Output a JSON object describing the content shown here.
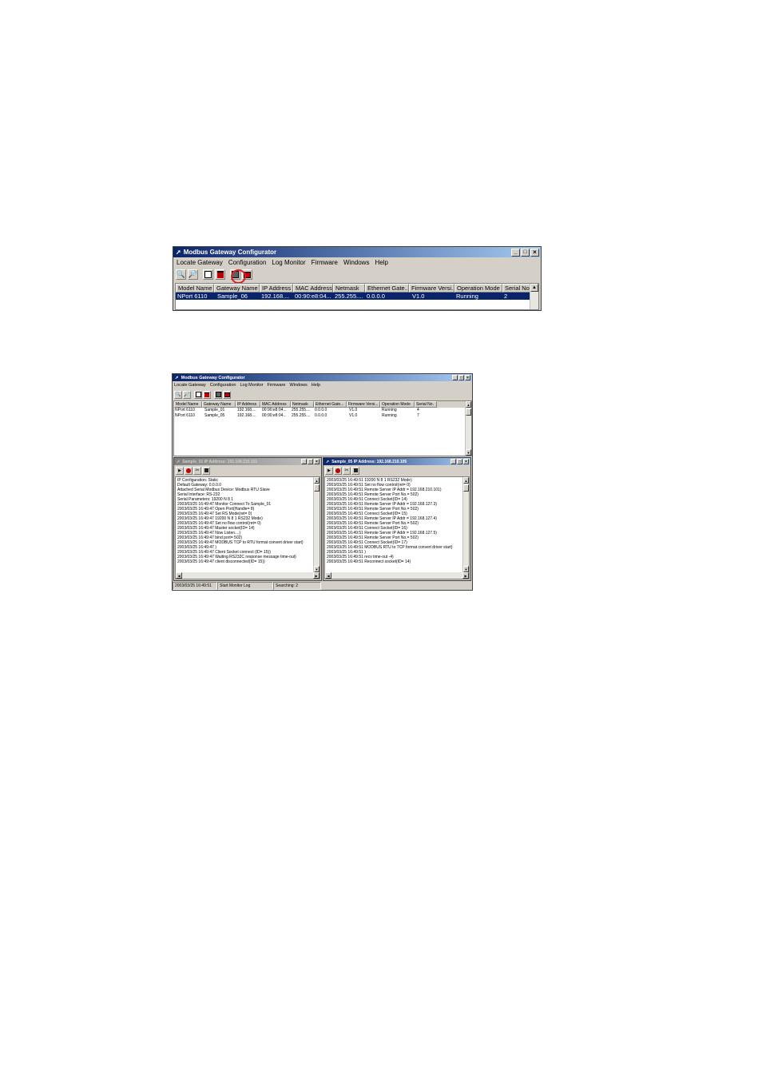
{
  "app": {
    "title": "Modbus Gateway Configurator",
    "menu": [
      "Locate Gateway",
      "Configuration",
      "Log Monitor",
      "Firmware",
      "Windows",
      "Help"
    ],
    "caption_buttons": [
      "_",
      "□",
      "×"
    ],
    "toolbar_icons": [
      "locate-icon",
      "locate-by-ip-icon",
      "configure-icon",
      "unlock-icon",
      "monitor-icon",
      "export-icon"
    ]
  },
  "top_window": {
    "columns": [
      "Model Name",
      "Gateway Name",
      "IP Address",
      "MAC Address",
      "Netmask",
      "Ethernet Gate...",
      "Firmware Versi...",
      "Operation Mode",
      "Serial No."
    ],
    "rows": [
      [
        "NPort 6110",
        "Sample_06",
        "192.168....",
        "00:90:e8:04...",
        "255.255....",
        "0.0.0.0",
        "V1.0",
        "Running",
        "2"
      ]
    ]
  },
  "bottom_window": {
    "columns": [
      "Model Name",
      "Gateway Name",
      "IP Address",
      "MAC Address",
      "Netmask",
      "Ethernet Gate...",
      "Firmware Versi...",
      "Operation Mode",
      "Serial No."
    ],
    "rows": [
      [
        "NPort 6110",
        "Sample_01",
        "192.168....",
        "00:90:e8:04...",
        "255.255....",
        "0.0.0.0",
        "V1.0",
        "Running",
        "4"
      ],
      [
        "NPort 6110",
        "Sample_05",
        "192.168....",
        "00:90:e8:04...",
        "255.255....",
        "0.0.0.0",
        "V1.0",
        "Running",
        "7"
      ]
    ],
    "log_left": {
      "title": "Sample_01 IP Address: 192.168.210.101",
      "lines": [
        "IP Configuration: Static",
        "Default Gateway: 0.0.0.0",
        "Attached Serial Modbus Device: Modbus RTU Slave",
        "Serial Interface: RS-232",
        "Serial Parameters: 19200 N 8 1",
        "2003/03/25 16:49:47 Monitor Connect To Sample_01",
        "2003/03/25 16:49:47 Open Port(Handle= 8)",
        "2003/03/25 16:49:47 Set RS Mode(ret= 0)",
        "2003/03/25 16:49:47 19200 N 8 1 RS232 Mode)",
        "2003/03/25 16:49:47 Set no flow control(ret= 0)",
        "2003/03/25 16:49:47 Master socket(ID= 14)",
        "2003/03/25 16:49:47 Now Listen....)",
        "2003/03/25 16:49:47 bind port= 502)",
        "2003/03/25 16:49:47 MODBUS TCP to RTU format convert driver start)",
        "2003/03/25 16:49:47 )",
        "2003/03/25 16:49:47 Client Socket connect (ID= 15))",
        "2003/03/25 16:49:47 Waiting RS232C response message time-out)",
        "2003/03/25 16:49:47 client disconnected(ID= 15))"
      ]
    },
    "log_right": {
      "title": "Sample_05 IP Address: 192.168.210.105",
      "lines": [
        "2003/03/25 16:49:51 19200 N 8 1 RS232 Mode)",
        "2003/03/25 16:49:51 Set no flow control(ret= 0)",
        "2003/03/25 16:49:51 Remote Server IP Addr = 192.168.210.101)",
        "2003/03/25 16:49:51 Remote Server Port No.= 502)",
        "2003/03/25 16:49:51 Connect Socket(ID= 14)",
        "2003/03/25 16:49:51 Remote Server IP Addr = 192.168.127.3)",
        "2003/03/25 16:49:51 Remote Server Port No.= 502)",
        "2003/03/25 16:49:51 Connect Socket(ID= 15)",
        "2003/03/25 16:49:51 Remote Server IP Addr = 192.168.127.4)",
        "2003/03/25 16:49:51 Remote Server Port No.= 502)",
        "2003/03/25 16:49:51 Connect Socket(ID= 16)",
        "2003/03/25 16:49:51 Remote Server IP Addr = 192.168.127.5)",
        "2003/03/25 16:49:51 Remote Server Port No.= 502)",
        "2003/03/25 16:49:51 Connect Socket(ID= 17)",
        "2003/03/25 16:49:51 MODBUS RTU to TCP format convert driver start)",
        "2003/03/25 16:49:51 )",
        "2003/03/25 16:49:51 recv time-out -4)",
        "2003/03/25 16:49:51 Reconnect socket(ID= 14)"
      ]
    },
    "status": [
      "2003/03/25 16:49:51",
      "Start Monitor Log",
      "Searching: 2"
    ]
  },
  "colors": {
    "title_active": "#0a246a",
    "title_inactive": "#808080",
    "highlight": "#0a246a",
    "face": "#d4d0c8"
  }
}
